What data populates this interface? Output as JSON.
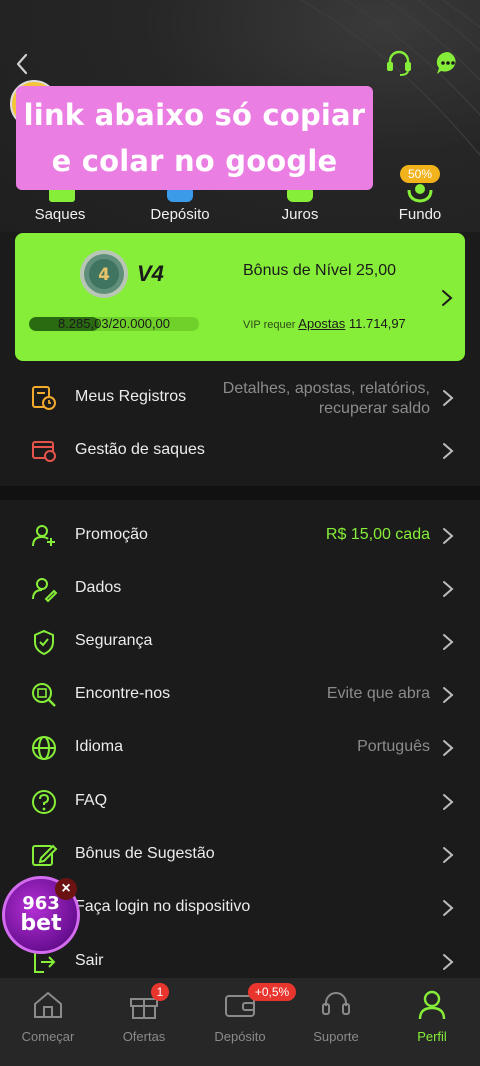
{
  "banner": {
    "line1": "link abaixo só copiar",
    "line2": "e colar no google"
  },
  "quick_actions": [
    {
      "label": "Saques",
      "icon": "wallet-icon"
    },
    {
      "label": "Depósito",
      "icon": "deposit-icon"
    },
    {
      "label": "Juros",
      "icon": "interest-icon"
    },
    {
      "label": "Fundo",
      "icon": "fund-icon",
      "badge": "50%"
    }
  ],
  "vip": {
    "level": "V4",
    "medal_number": "4",
    "bonus_text": "Bônus de Nível 25,00",
    "progress_text": "8.285,03/20.000,00",
    "progress_fraction": 0.414,
    "requirement_prefix": "VIP requer",
    "requirement_link": "Apostas",
    "requirement_value": "11.714,97"
  },
  "menu_top": [
    {
      "label": "Meus Registros",
      "value_line1": "Detalhes, apostas, relatórios,",
      "value_line2": "recuperar saldo",
      "icon": "records-icon"
    },
    {
      "label": "Gestão de saques",
      "value": "",
      "icon": "withdraw-management-icon"
    }
  ],
  "menu": [
    {
      "label": "Promoção",
      "value": "R$ 15,00 cada",
      "icon": "promotion-user-icon"
    },
    {
      "label": "Dados",
      "value": "",
      "icon": "user-edit-icon"
    },
    {
      "label": "Segurança",
      "value": "",
      "icon": "shield-check-icon"
    },
    {
      "label": "Encontre-nos",
      "value": "Evite que abra",
      "icon": "find-us-icon"
    },
    {
      "label": "Idioma",
      "value": "Português",
      "icon": "globe-icon"
    },
    {
      "label": "FAQ",
      "value": "",
      "icon": "question-icon"
    },
    {
      "label": "Bônus de Sugestão",
      "value": "",
      "icon": "edit-icon"
    },
    {
      "label": "Faça login no dispositivo",
      "value": "",
      "icon": "device-login-icon"
    },
    {
      "label": "Sair",
      "value": "",
      "icon": "logout-icon"
    }
  ],
  "floating_ad": {
    "number": "963",
    "text": "bet",
    "close": "×"
  },
  "tabbar": [
    {
      "label": "Começar",
      "icon": "home-icon"
    },
    {
      "label": "Ofertas",
      "icon": "gift-icon",
      "badge": "1"
    },
    {
      "label": "Depósito",
      "icon": "wallet-deposit-icon",
      "badge": "+0,5%"
    },
    {
      "label": "Suporte",
      "icon": "headset-icon"
    },
    {
      "label": "Perfil",
      "icon": "profile-icon",
      "active": true
    }
  ],
  "colors": {
    "accent": "#86ee38",
    "background": "#1b1b1b",
    "banner": "#eb7ee3",
    "badge_red": "#e8362f",
    "badge_orange": "#f2b21c"
  }
}
